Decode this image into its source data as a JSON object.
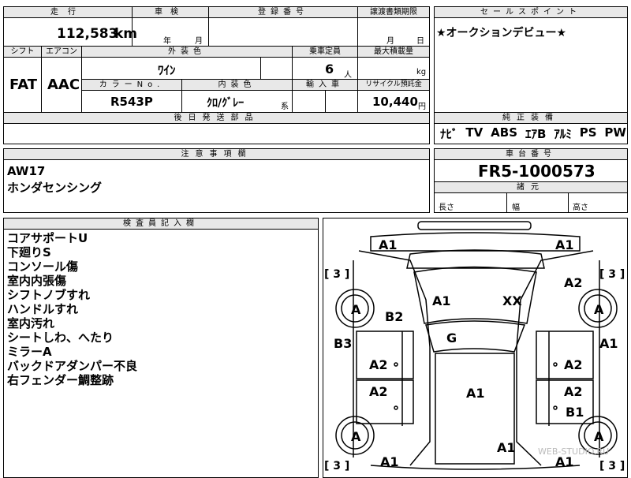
{
  "headers": {
    "mileage": "走行",
    "inspection": "車検",
    "registration": "登録番号",
    "transfer_deadline": "譲渡書類期限",
    "sales_points": "セールスポイント",
    "shift": "シフト",
    "aircon": "エアコン",
    "exterior_color": "外装色",
    "capacity": "乗車定員",
    "max_load": "最大積載量",
    "color_no": "カラーNo.",
    "interior_color": "内装色",
    "import": "輸入車",
    "recycle": "リサイクル預託金",
    "later_parts": "後日発送部品",
    "equipment": "純正装備",
    "notes": "注意事項欄",
    "chassis_no": "車台番号",
    "dimensions": "諸元",
    "inspector": "検査員記入欄"
  },
  "values": {
    "mileage": "112,583",
    "mileage_unit": "km",
    "inspection_year": "年",
    "inspection_month": "月",
    "transfer_month": "月",
    "transfer_day": "日",
    "sales_point_text": "★オークションデビュー★",
    "shift": "FAT",
    "aircon": "AAC",
    "exterior_color": "ﾜｲﾝ",
    "capacity": "6",
    "capacity_unit": "人",
    "max_load_unit": "kg",
    "color_no": "R543P",
    "interior_color": "ｸﾛ/ｸﾞﾚｰ",
    "interior_suffix": "系",
    "recycle": "10,440",
    "recycle_unit": "円",
    "equipment": [
      "ﾅﾋﾞ",
      "TV",
      "ABS",
      "ｴｱB",
      "ｱﾙﾐ",
      "PS",
      "PW"
    ],
    "notes": [
      "AW17",
      "ホンダセンシング"
    ],
    "chassis_no": "FR5-1000573",
    "dim_length": "長さ",
    "dim_width": "幅",
    "dim_height": "高さ"
  },
  "inspector_notes": [
    "コアサポートU",
    "下廻りS",
    "コンソール傷",
    "室内内張傷",
    "シフトノブすれ",
    "ハンドルすれ",
    "室内汚れ",
    "シートしわ、へたり",
    "ミラーA",
    "バックドアダンパー不良",
    "右フェンダー鯛整跡"
  ],
  "diagram": {
    "tire_label": "[ 3 ]",
    "wheel_label": "A",
    "marks": {
      "front_left": "A1",
      "front_right": "A1",
      "left_fender": "A2",
      "right_fender": "A2",
      "hood": "A1",
      "hood_right": "XX",
      "left_front_door_area": "B2",
      "left_side": "B3",
      "right_side": "A1",
      "windshield": "G",
      "left_front_door": "A2",
      "right_front_door": "A2",
      "left_rear_door": "A2",
      "right_rear_door": "A2",
      "roof": "A1",
      "right_rear_door_lower": "B1",
      "rear": "A1",
      "rear_left": "A1",
      "rear_right": "A1"
    }
  },
  "watermark": "WEB-STUDIO.RU"
}
